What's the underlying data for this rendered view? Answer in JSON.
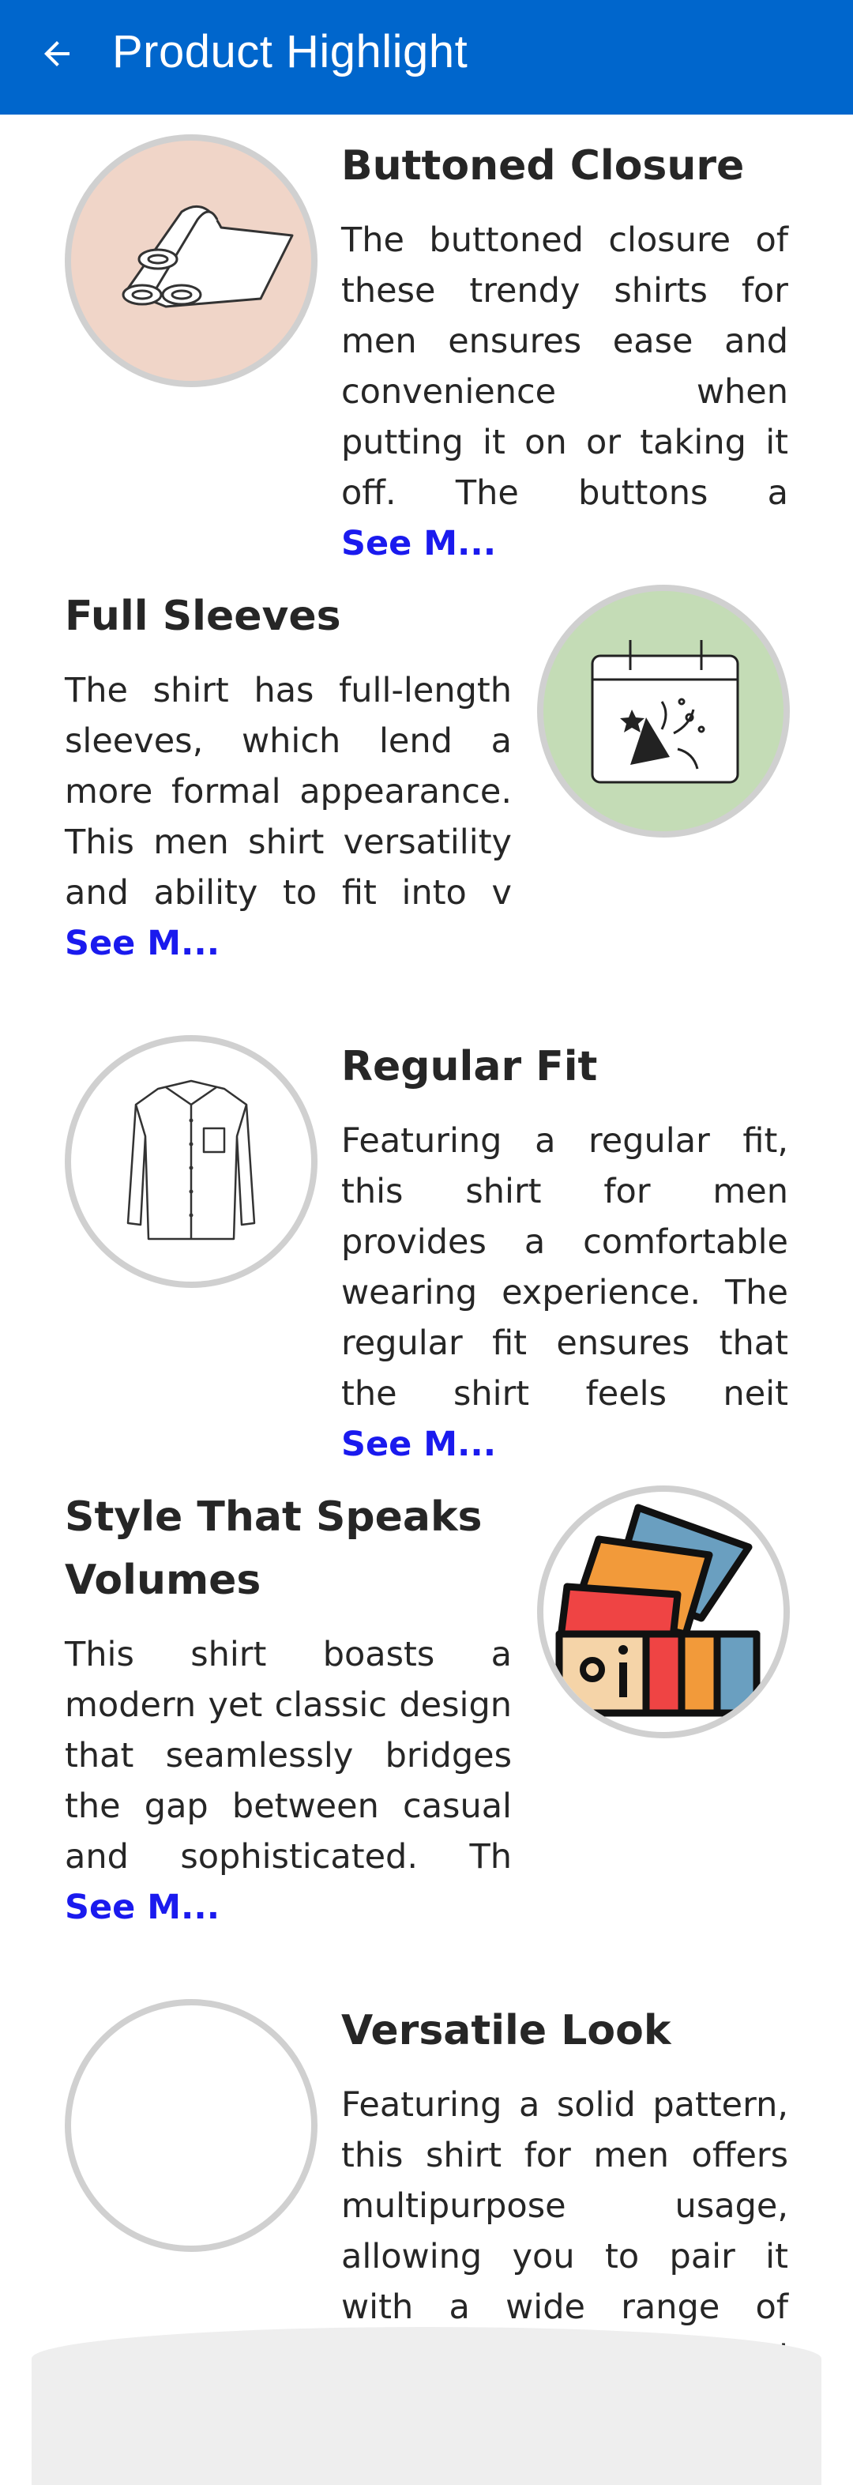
{
  "appbar": {
    "title": "Product Highlight",
    "back_icon": "arrow-left-icon",
    "color": "#0066cc"
  },
  "see_more_label": "See M...",
  "highlights": [
    {
      "title": "Buttoned Closure",
      "description": "The buttoned closure of these trendy shirts for men ensures ease and convenience when putting it on or taking it off. The buttons a",
      "icon": "fabric-rolls-icon",
      "icon_bg": "#f0d5c8"
    },
    {
      "title": "Full Sleeves",
      "description": "The shirt has full-length sleeves, which lend a more formal appearance. This men shirt versatility and ability to fit into v",
      "icon": "party-calendar-icon",
      "icon_bg": "#c4dcb6"
    },
    {
      "title": "Regular Fit",
      "description": "Featuring a regular fit, this shirt for men provides a comfortable wearing experience. The regular fit ensures that the shirt feels neit",
      "icon": "shirt-icon",
      "icon_bg": "#ffffff"
    },
    {
      "title": "Style That Speaks Volumes",
      "description": "This shirt boasts a modern yet classic design that seamlessly bridges the gap between casual and sophisticated. Th",
      "icon": "color-palette-icon",
      "icon_bg": "#ffffff"
    },
    {
      "title": "Versatile Look",
      "description": "Featuring a solid pattern, this shirt for men offers multipurpose usage, allowing you to pair it with a wide range of pants, shorts, or j",
      "icon": "empty-icon",
      "icon_bg": "#ffffff"
    }
  ]
}
